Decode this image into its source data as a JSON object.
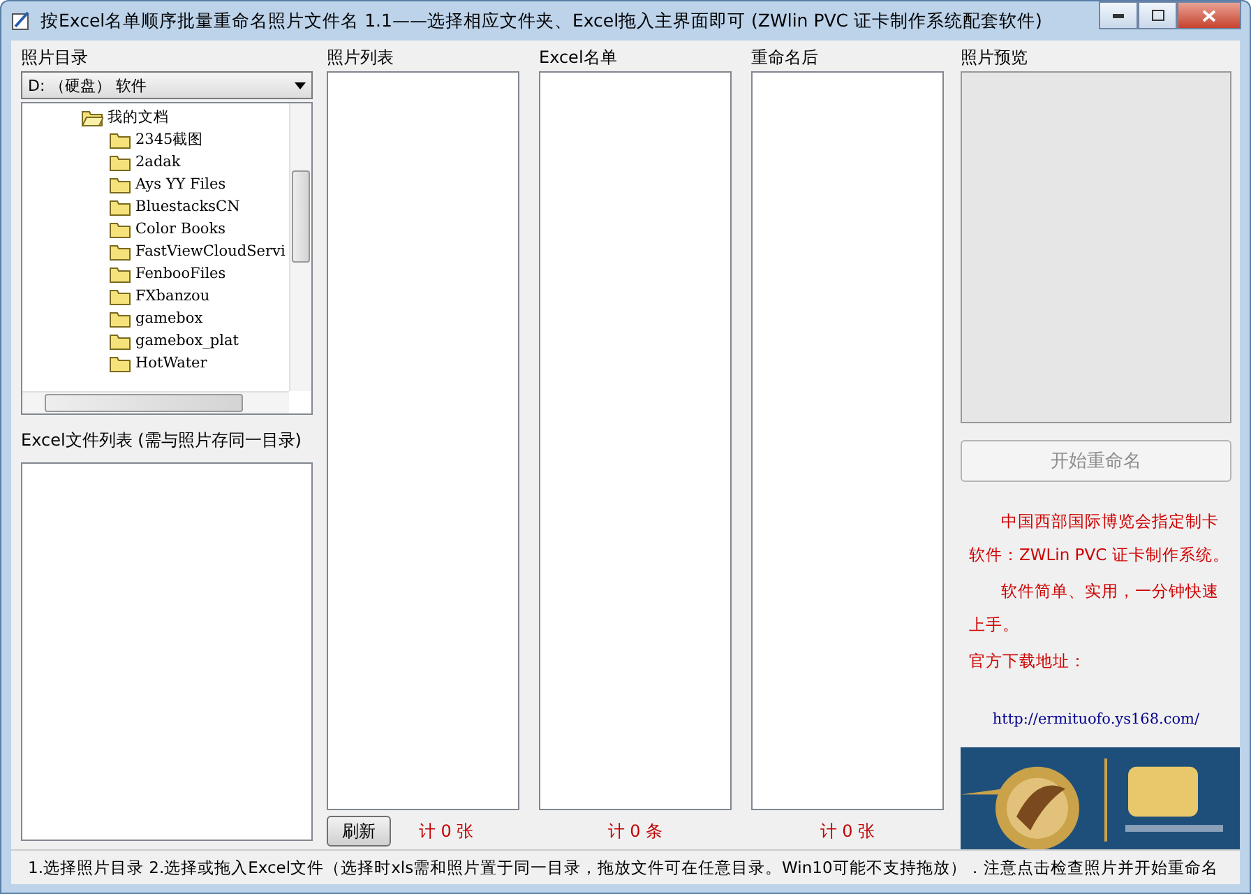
{
  "window": {
    "title": "按Excel名单顺序批量重命名照片文件名 1.1——选择相应文件夹、Excel拖入主界面即可 (ZWlin PVC 证卡制作系统配套软件)"
  },
  "left": {
    "label": "照片目录",
    "drive": "D: （硬盘） 软件",
    "tree": [
      {
        "name": "我的文档",
        "expanded": true,
        "children": [
          {
            "name": "2345截图"
          },
          {
            "name": "2adak"
          },
          {
            "name": "Ays YY Files"
          },
          {
            "name": "BluestacksCN"
          },
          {
            "name": "Color Books"
          },
          {
            "name": "FastViewCloudServi"
          },
          {
            "name": "FenbooFiles"
          },
          {
            "name": "FXbanzou"
          },
          {
            "name": "gamebox"
          },
          {
            "name": "gamebox_plat"
          },
          {
            "name": "HotWater"
          }
        ]
      }
    ],
    "excel_list_label": "Excel文件列表 (需与照片存同一目录)"
  },
  "columns": [
    {
      "label": "照片列表",
      "count": "计 0 张",
      "has_refresh": true
    },
    {
      "label": "Excel名单",
      "count": "计 0 条",
      "has_refresh": false
    },
    {
      "label": "重命名后",
      "count": "计 0 张",
      "has_refresh": false
    }
  ],
  "refresh_button": "刷新",
  "preview": {
    "label": "照片预览",
    "button": "开始重命名",
    "button_disabled": true,
    "notes": [
      {
        "text": "中国西部国际博览会指定制卡软件：ZWLin PVC 证卡制作系统。",
        "indent": true
      },
      {
        "text": "软件简单、实用，一分钟快速上手。",
        "indent": true
      },
      {
        "text": "官方下载地址：",
        "indent": false
      }
    ],
    "link": "http://ermituofo.ys168.com/"
  },
  "status_bar": "1.选择照片目录 2.选择或拖入Excel文件（选择时xls需和照片置于同一目录，拖放文件可在任意目录。Win10可能不支持拖放）．注意点击检查照片并开始重命名"
}
